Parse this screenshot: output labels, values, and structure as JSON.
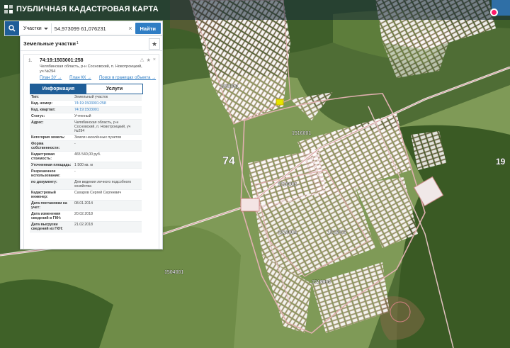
{
  "app": {
    "title": "ПУБЛИЧНАЯ КАДАСТРОВАЯ КАРТА"
  },
  "search": {
    "type_label": "Участки",
    "value": "54,973099 61,076231",
    "clear_label": "×",
    "button_label": "Найти"
  },
  "panel": {
    "title": "Земельные участки",
    "count": "1"
  },
  "parcel": {
    "index": "1.",
    "number": "74:19:1503001:258",
    "address": "Челябинская область, р-н Сосновский, п. Новотроицкий, уч №294",
    "links": [
      "План ЗУ →",
      "План КК →",
      "Поиск в границах объекта →"
    ],
    "tabs": [
      "Информация",
      "Услуги"
    ],
    "rows": [
      {
        "label": "Тип:",
        "value": "Земельный участок"
      },
      {
        "label": "Кад. номер:",
        "value": "74:19:1503001:258"
      },
      {
        "label": "Кад. квартал:",
        "value": "74:19:1503001"
      },
      {
        "label": "Статус:",
        "value": "Учтенный"
      },
      {
        "label": "Адрес:",
        "value": "Челябинская область, р-н Сосновский, п. Новотроицкий, уч №294"
      },
      {
        "label": "Категория земель:",
        "value": "Земли населённых пунктов"
      },
      {
        "label": "Форма собственности:",
        "value": "-"
      },
      {
        "label": "Кадастровая стоимость:",
        "value": "465 540,00 руб."
      },
      {
        "label": "Уточненная площадь:",
        "value": "1 500 кв. м"
      },
      {
        "label": "Разрешенное использование:",
        "value": "-"
      },
      {
        "label": "по документу:",
        "value": "Для ведения личного подсобного хозяйства"
      },
      {
        "label": "Кадастровый инженер:",
        "value": "Сахаров Сергей Сергеевич"
      },
      {
        "label": "Дата постановки на учет:",
        "value": "08.01.2014"
      },
      {
        "label": "Дата изменения сведений в ГКН:",
        "value": "20.02.2018"
      },
      {
        "label": "Дата выгрузки сведений из ГКН:",
        "value": "21.02.2018"
      }
    ]
  },
  "map": {
    "labels": {
      "district_74": "74",
      "district_19": "19",
      "block_1503001": "1503001",
      "block_1516001": "1516001",
      "block_1516002": "1516002",
      "block_1516004": "1516004",
      "block_1516003": "1516003",
      "block_1516005": "1516005",
      "block_1504001": "1504001",
      "block_west": "1504001"
    }
  }
}
